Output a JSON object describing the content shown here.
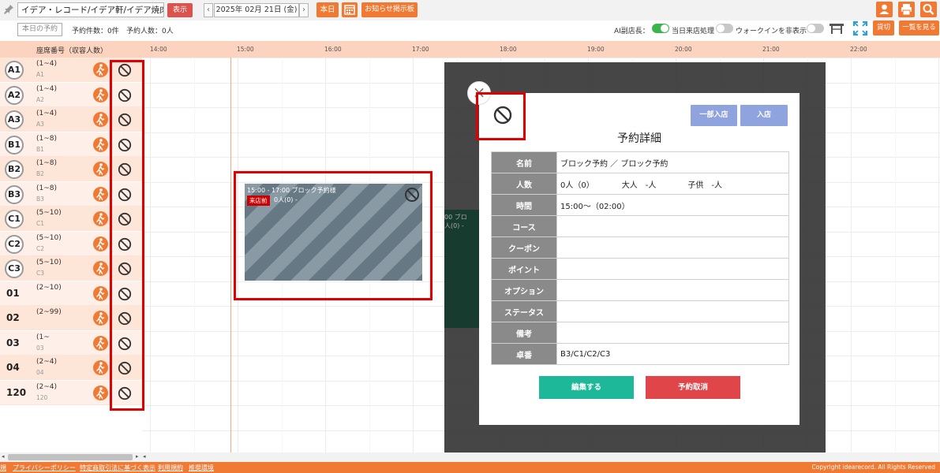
{
  "topbar": {
    "store_name": "イデア・レコード/イデア軒/イデア焼肉",
    "show_button": "表示",
    "date": "2025年 02月 21日 (金)",
    "today_button": "本日",
    "notice_button": "お知らせ掲示板",
    "prev": "‹",
    "next": "›"
  },
  "row2": {
    "today_reservations": "本日の予約",
    "reservation_count": "予約件数：0件",
    "reservation_people": "予約人数：0人",
    "ai_label": "AI副店長：",
    "same_day_label": "当日来店処理",
    "walkin_label": "ウォークインを非表示",
    "lend_button": "貸切",
    "list_button": "一覧を見る"
  },
  "grid": {
    "seat_title": "座席番号（収容人数）",
    "times": [
      "14:00",
      "15:00",
      "16:00",
      "17:00",
      "18:00",
      "19:00",
      "20:00",
      "21:00",
      "22:00"
    ]
  },
  "seats": [
    {
      "name": "A1",
      "cap": "(1~4)",
      "sub": "A1",
      "circle": true
    },
    {
      "name": "A2",
      "cap": "(1~4)",
      "sub": "A2",
      "circle": true
    },
    {
      "name": "A3",
      "cap": "(1~4)",
      "sub": "A3",
      "circle": true
    },
    {
      "name": "B1",
      "cap": "(1~8)",
      "sub": "B1",
      "circle": true
    },
    {
      "name": "B2",
      "cap": "(1~8)",
      "sub": "B2",
      "circle": true
    },
    {
      "name": "B3",
      "cap": "(1~8)",
      "sub": "B3",
      "circle": true
    },
    {
      "name": "C1",
      "cap": "(5~10)",
      "sub": "C1",
      "circle": true
    },
    {
      "name": "C2",
      "cap": "(5~10)",
      "sub": "C2",
      "circle": true
    },
    {
      "name": "C3",
      "cap": "(5~10)",
      "sub": "C3",
      "circle": true
    },
    {
      "name": "01",
      "cap": "(2~10)",
      "sub": "",
      "circle": false
    },
    {
      "name": "02",
      "cap": "(2~99)",
      "sub": "",
      "circle": false
    },
    {
      "name": "03",
      "cap": "(1~",
      "sub": "03",
      "circle": false
    },
    {
      "name": "04",
      "cap": "(2~4)",
      "sub": "04",
      "circle": false
    },
    {
      "name": "120",
      "cap": "(2~4)",
      "sub": "120",
      "circle": false
    }
  ],
  "reservation_card": {
    "time": "15:00 - 17:00 ブロック予約様",
    "tag": "来店前",
    "count": "0人(0) -"
  },
  "background_card": {
    "time": "00 ブロ",
    "count": "人(0) -"
  },
  "modal": {
    "close": "×",
    "partial_button": "一部入店",
    "enter_button": "入店",
    "title": "予約詳細",
    "rows": [
      {
        "label": "名前",
        "value": "ブロック予約 ／ ブロック予約"
      },
      {
        "label": "人数",
        "value": "0人（0）　　　　大人　-人　　　　子供　-人"
      },
      {
        "label": "時間",
        "value": "15:00～（02:00）"
      },
      {
        "label": "コース",
        "value": ""
      },
      {
        "label": "クーポン",
        "value": ""
      },
      {
        "label": "ポイント",
        "value": ""
      },
      {
        "label": "オプション",
        "value": ""
      },
      {
        "label": "ステータス",
        "value": ""
      },
      {
        "label": "備考",
        "value": ""
      },
      {
        "label": "卓番",
        "value": "B3/C1/C2/C3"
      }
    ],
    "edit_button": "編集する",
    "cancel_button": "予約取消"
  },
  "footer": {
    "links": [
      "規",
      "プライバシーポリシー",
      "特定商取引法に基づく表示",
      "利用規約",
      "推奨環境"
    ],
    "copyright": "Copyright idearecord. All Rights Reserved"
  }
}
